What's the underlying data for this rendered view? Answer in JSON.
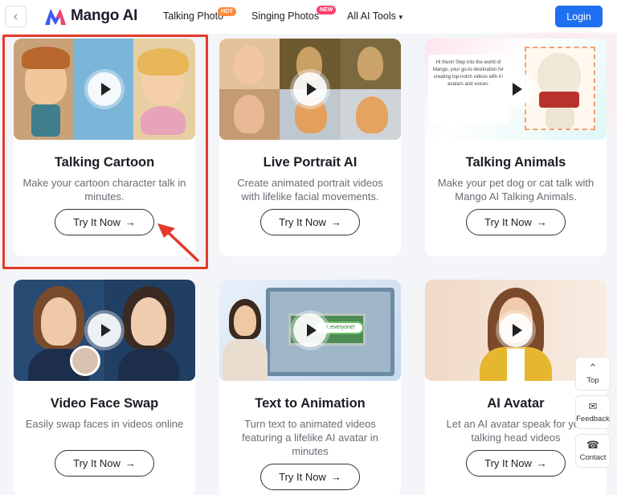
{
  "header": {
    "back_icon": "chevron-left-icon",
    "brand": "Mango AI",
    "nav": [
      {
        "label": "Talking Photo",
        "badge": "HOT"
      },
      {
        "label": "Singing Photos",
        "badge": "NEW"
      },
      {
        "label": "All AI Tools",
        "icon": "caret-down-icon"
      }
    ],
    "login_label": "Login"
  },
  "cards": [
    {
      "title": "Talking Cartoon",
      "description": "Make your cartoon character talk in minutes.",
      "button": "Try It Now",
      "button_icon": "arrow-right-icon"
    },
    {
      "title": "Live Portrait AI",
      "description": "Create animated portrait videos with lifelike facial movements.",
      "button": "Try It Now",
      "button_icon": "arrow-right-icon"
    },
    {
      "title": "Talking Animals",
      "description": "Make your pet dog or cat talk with Mango AI Talking Animals.",
      "button": "Try It Now",
      "button_icon": "arrow-right-icon",
      "thumb_text": "Hi there! Step into the world of Mango, your go-to destination for creating top-notch videos with AI avatars and voices."
    },
    {
      "title": "Video Face Swap",
      "description": "Easily swap faces in videos online",
      "button": "Try It Now",
      "button_icon": "arrow-right-icon"
    },
    {
      "title": "Text to Animation",
      "description": "Turn text to animated videos featuring a lifelike AI avatar in minutes",
      "button": "Try It Now",
      "button_icon": "arrow-right-icon",
      "thumb_text": "ck,everyone!"
    },
    {
      "title": "AI Avatar",
      "description": "Let an AI avatar speak for you talking head videos",
      "button": "Try It Now",
      "button_icon": "arrow-right-icon"
    }
  ],
  "side_widget": [
    {
      "label": "Top",
      "icon": "chevron-up-icon"
    },
    {
      "label": "Feedback",
      "icon": "mail-icon"
    },
    {
      "label": "Contact",
      "icon": "headset-icon"
    }
  ],
  "colors": {
    "primary": "#1f6ff1",
    "highlight": "#e43a2a",
    "hot_badge": "#ff8a3d",
    "new_badge": "#ff3d6e"
  }
}
